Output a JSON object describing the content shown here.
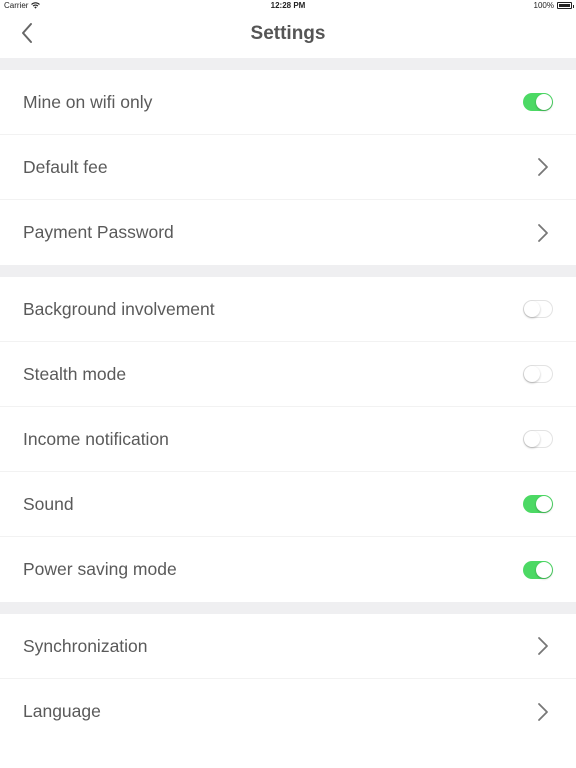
{
  "status_bar": {
    "carrier": "Carrier",
    "time": "12:28 PM",
    "battery": "100%"
  },
  "nav": {
    "title": "Settings",
    "back_icon": "chevron-left-icon"
  },
  "colors": {
    "toggle_on": "#4cd964",
    "section_gap": "#efeff1",
    "text": "#5a5a5a"
  },
  "sections": [
    [
      {
        "label": "Mine on wifi only",
        "control": "toggle",
        "on": true
      },
      {
        "label": "Default fee",
        "control": "chevron"
      },
      {
        "label": "Payment Password",
        "control": "chevron"
      }
    ],
    [
      {
        "label": "Background involvement",
        "control": "toggle",
        "on": false
      },
      {
        "label": "Stealth mode",
        "control": "toggle",
        "on": false
      },
      {
        "label": "Income notification",
        "control": "toggle",
        "on": false
      },
      {
        "label": "Sound",
        "control": "toggle",
        "on": true
      },
      {
        "label": "Power saving mode",
        "control": "toggle",
        "on": true
      }
    ],
    [
      {
        "label": "Synchronization",
        "control": "chevron"
      },
      {
        "label": "Language",
        "control": "chevron"
      }
    ]
  ]
}
